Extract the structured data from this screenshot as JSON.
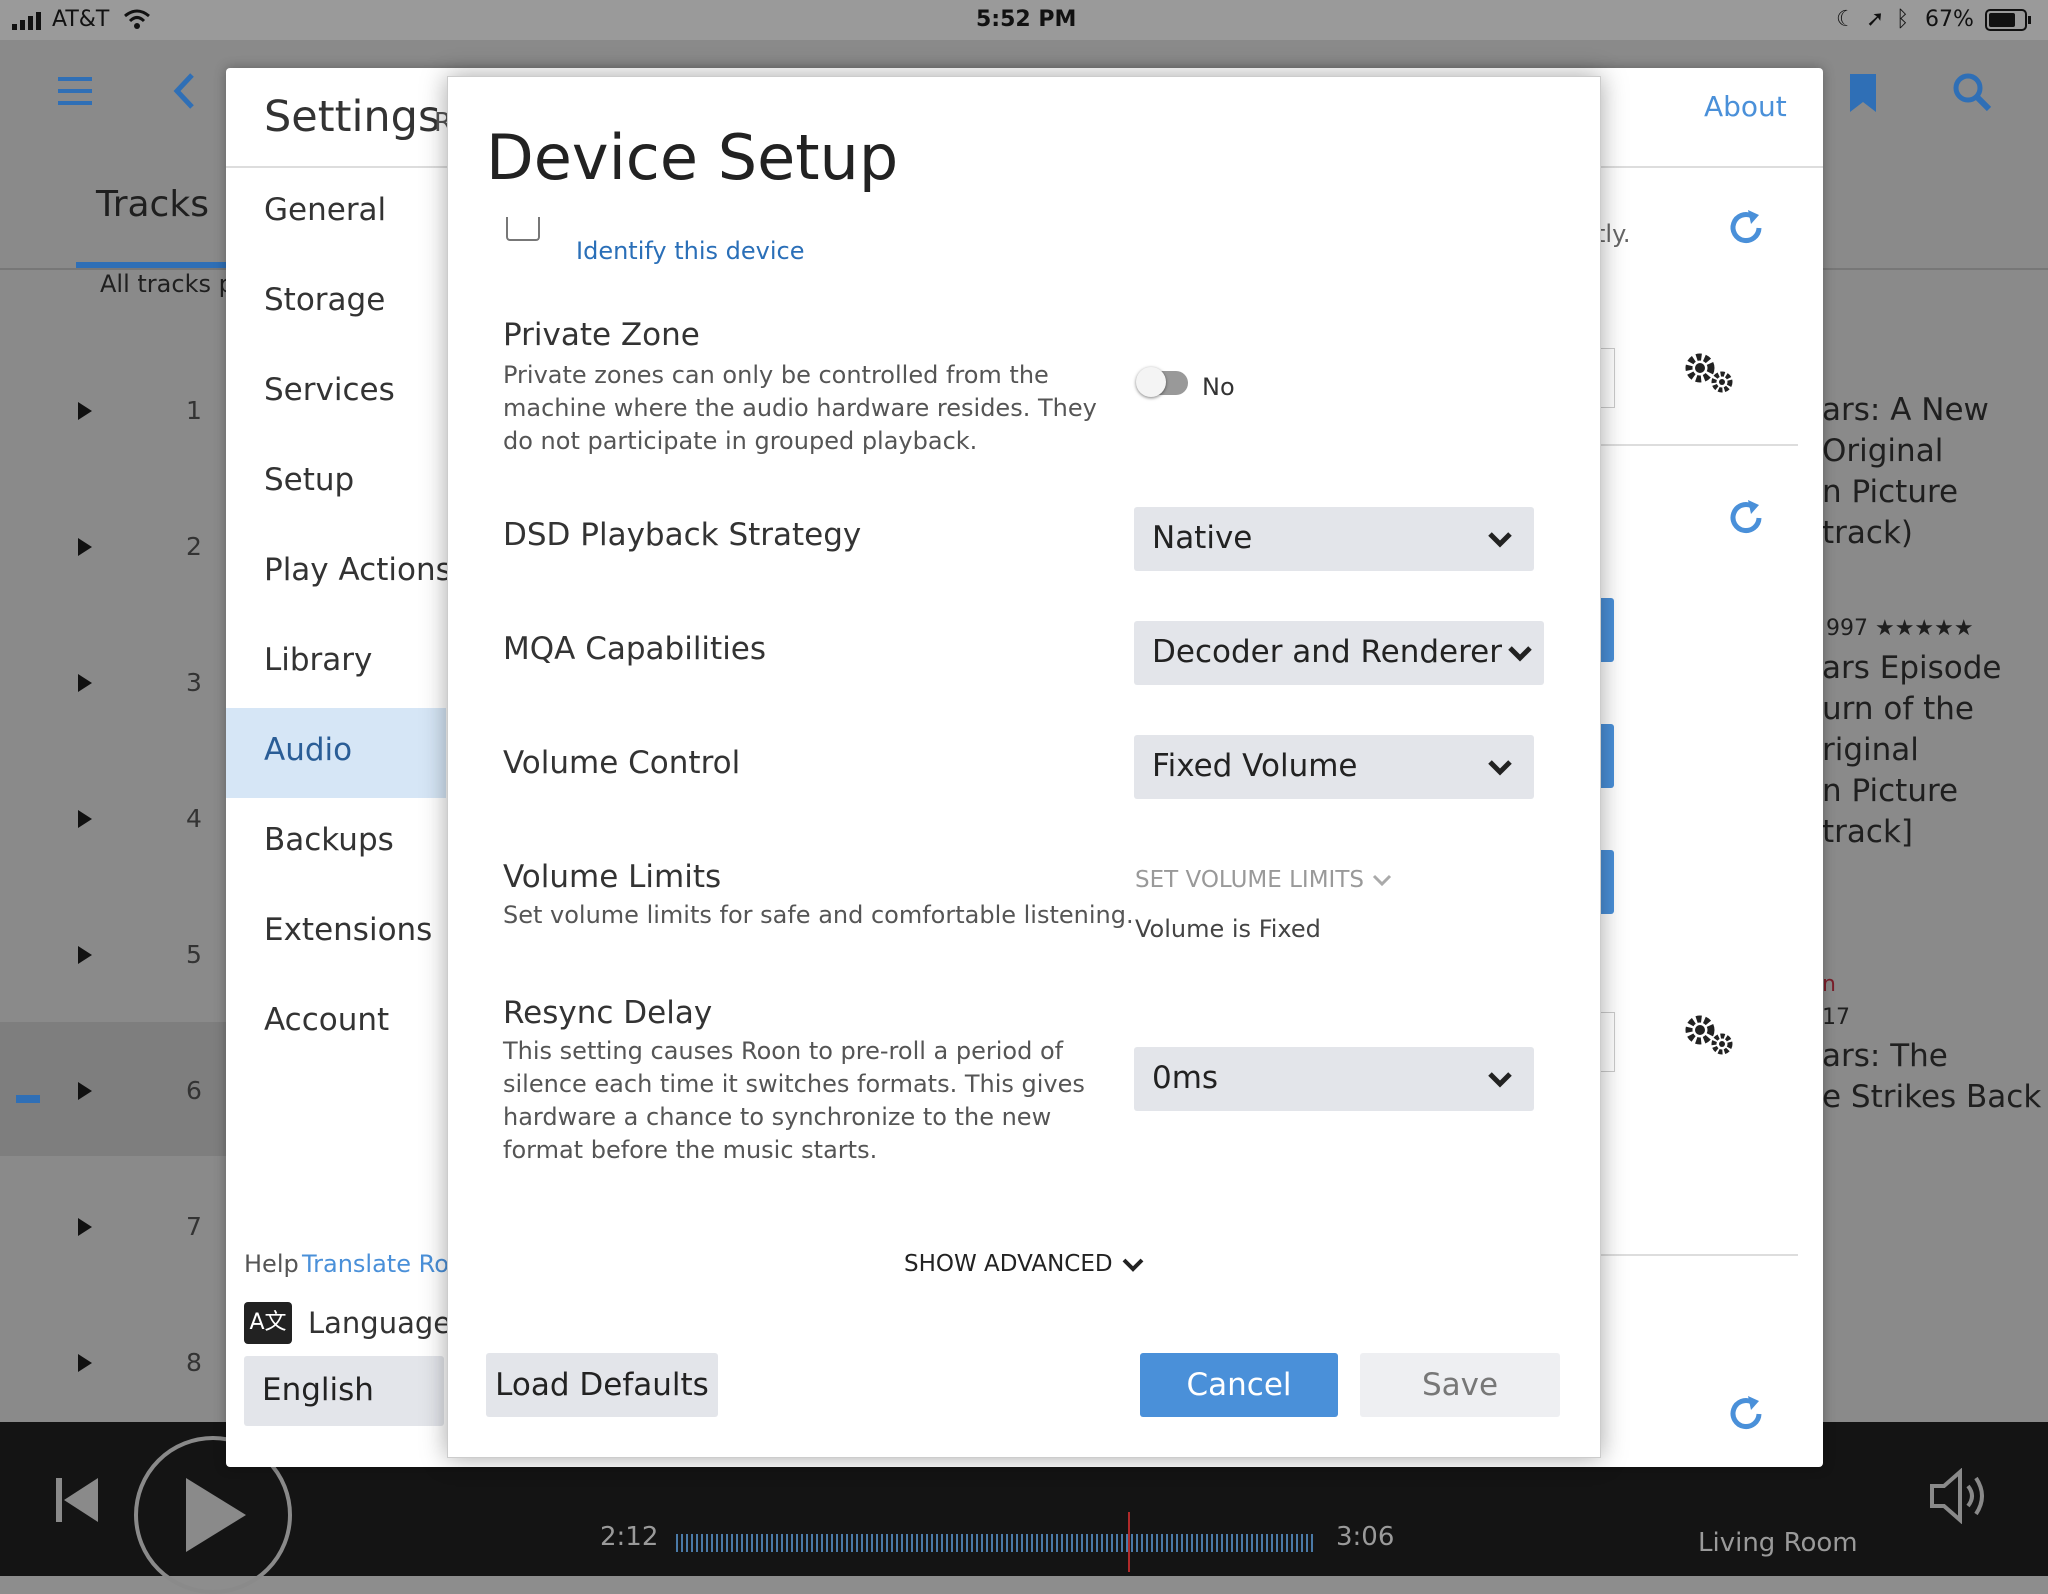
{
  "status": {
    "carrier": "AT&T",
    "time": "5:52 PM",
    "battery": "67%"
  },
  "background": {
    "tabs": {
      "tracks": "Tracks",
      "all_tracks": "All tracks p"
    },
    "track_numbers": [
      "1",
      "2",
      "3",
      "4",
      "5",
      "6",
      "7",
      "8"
    ],
    "right_text": [
      "ars: A New",
      "Original",
      "n Picture",
      "track)",
      "997 ★★★★★",
      "ars Episode",
      "urn of the",
      "riginal",
      "n Picture",
      "track]",
      "n",
      "17",
      "ars: The",
      "e Strikes Back"
    ],
    "partial_text": "tly.",
    "player": {
      "elapsed": "2:12",
      "total": "3:06",
      "zone": "Living Room"
    }
  },
  "settings": {
    "title": "Settings",
    "title_partial": "R",
    "about": "About",
    "nav": [
      "General",
      "Storage",
      "Services",
      "Setup",
      "Play Actions",
      "Library",
      "Audio",
      "Backups",
      "Extensions",
      "Account"
    ],
    "active_nav": "Audio",
    "help_label": "Help",
    "translate_link": "Translate Ro",
    "language_label": "Language",
    "language_value": "English"
  },
  "dialog": {
    "title": "Device Setup",
    "identify_link": "Identify this device",
    "private_zone": {
      "label": "Private Zone",
      "description": "Private zones can only be controlled from the machine where the audio hardware resides. They do not participate in grouped playback.",
      "value": "No"
    },
    "dsd": {
      "label": "DSD Playback Strategy",
      "value": "Native"
    },
    "mqa": {
      "label": "MQA Capabilities",
      "value": "Decoder and Renderer"
    },
    "volume_control": {
      "label": "Volume Control",
      "value": "Fixed Volume"
    },
    "volume_limits": {
      "label": "Volume Limits",
      "description": "Set volume limits for safe and comfortable listening.",
      "action": "SET VOLUME LIMITS",
      "status": "Volume is Fixed"
    },
    "resync": {
      "label": "Resync Delay",
      "description": "This setting causes Roon to pre-roll a period of silence each time it switches formats. This gives hardware a chance to synchronize to the new format before the music starts.",
      "value": "0ms"
    },
    "show_advanced": "SHOW ADVANCED",
    "buttons": {
      "load_defaults": "Load Defaults",
      "cancel": "Cancel",
      "save": "Save"
    }
  },
  "colors": {
    "accent": "#4a90d9",
    "link": "#2a6fb8"
  }
}
